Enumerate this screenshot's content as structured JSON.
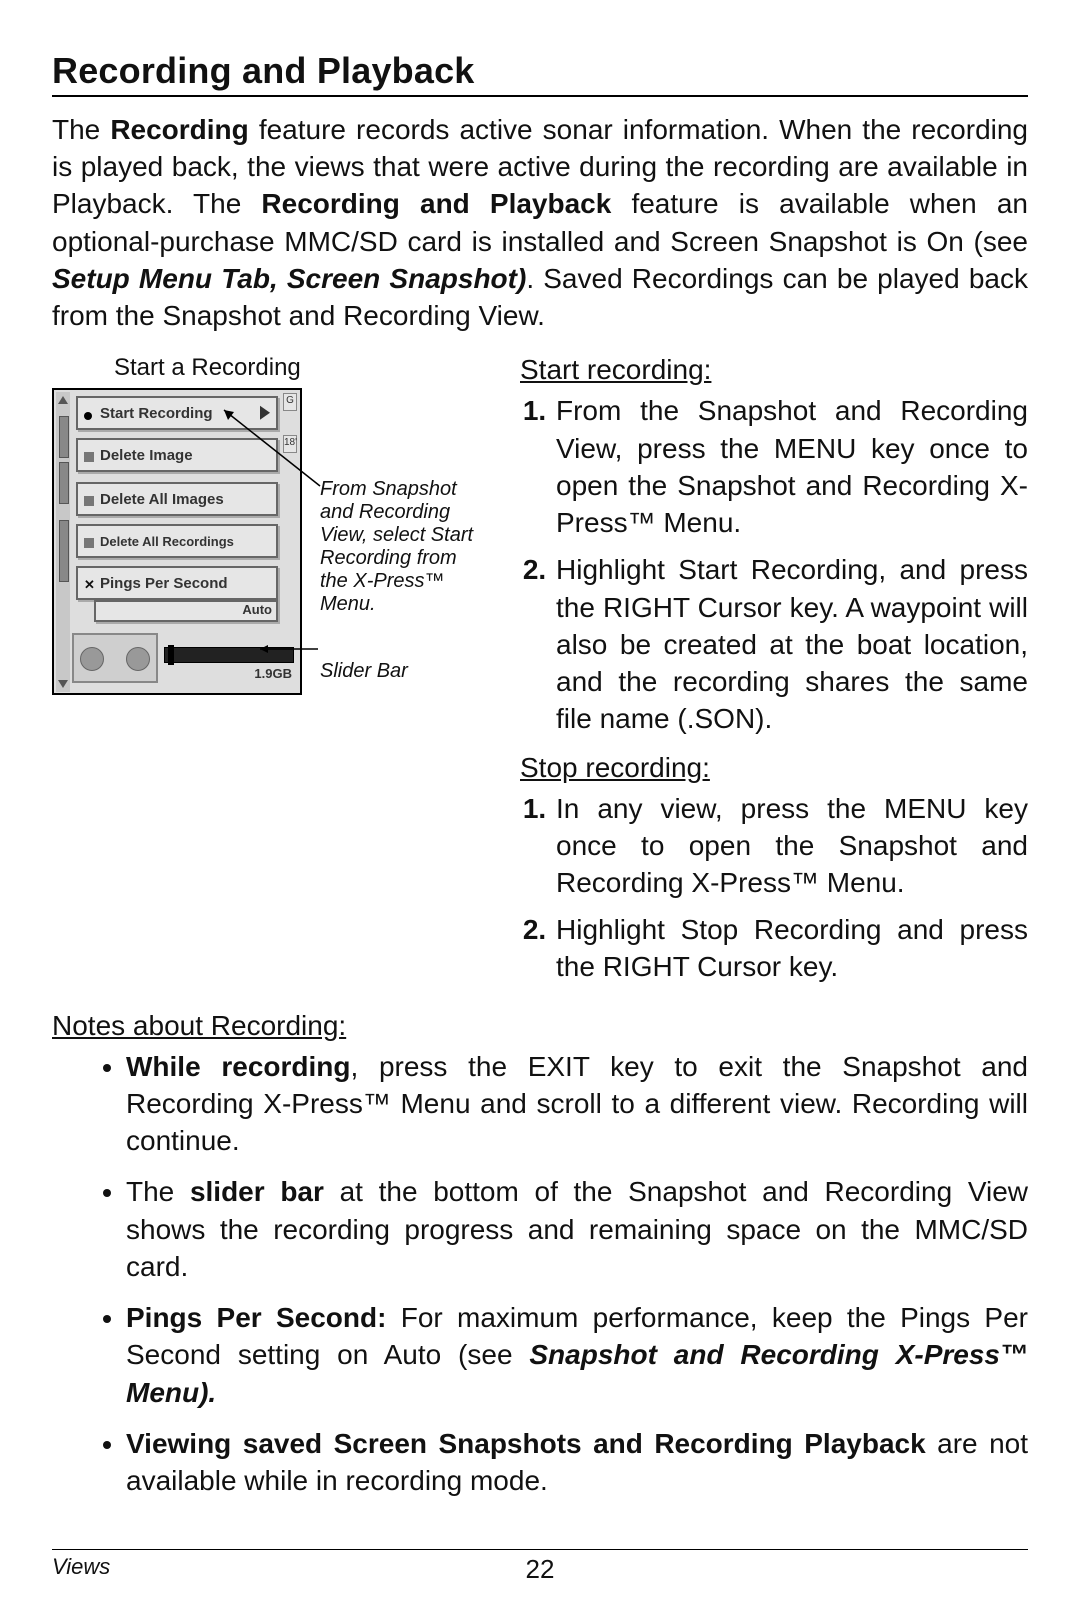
{
  "title": "Recording and Playback",
  "intro": {
    "t1": "The ",
    "b1": "Recording",
    "t2": " feature records active sonar information. When the recording is played back, the views that were active during the recording are available in Playback. The ",
    "b2": "Recording and Playback",
    "t3": " feature is available when an optional-purchase MMC/SD card is installed and Screen Snapshot is On (see ",
    "bi1": "Setup Menu Tab, Screen Snapshot)",
    "t4": ". Saved Recordings can be played back from the Snapshot and Recording View."
  },
  "figure": {
    "caption": "Start a Recording",
    "menu": {
      "start": "Start Recording",
      "del_img": "Delete Image",
      "del_all_img": "Delete All Images",
      "del_all_rec": "Delete All Recordings",
      "pps": "Pings Per Second",
      "auto": "Auto",
      "gb": "1.9GB",
      "rightG": "G",
      "right18": "18'"
    },
    "annot1": "From Snapshot and Recording View, select Start Recording from the\nX-Press™ Menu.",
    "annot2": "Slider Bar"
  },
  "start": {
    "heading": "Start recording:",
    "s1": "From the Snapshot and Recording View, press the MENU key once to open the Snapshot and Recording X-Press™ Menu.",
    "s2": "Highlight Start Recording, and press the RIGHT Cursor key. A waypoint will also be created at the boat location, and the recording shares the same file name (.SON)."
  },
  "stop": {
    "heading": "Stop recording:",
    "s1": "In any view, press the MENU key once to open the Snapshot and Recording X-Press™ Menu.",
    "s2": "Highlight Stop Recording and press the RIGHT Cursor key."
  },
  "notes": {
    "heading": "Notes about Recording:",
    "n1a": "While recording",
    "n1b": ", press the EXIT key to exit the Snapshot and Recording X-Press™ Menu and scroll to a different view. Recording will continue.",
    "n2a": "The ",
    "n2b": "slider bar",
    "n2c": " at the bottom of the Snapshot and Recording View shows the recording progress and remaining space on the MMC/SD card.",
    "n3a": "Pings Per Second:",
    "n3b": " For maximum performance, keep the Pings Per Second setting on Auto (see  ",
    "n3c": "Snapshot and Recording X-Press™ Menu).",
    "n4a": "Viewing saved Screen Snapshots and Recording Playback",
    "n4b": " are not available while in recording mode."
  },
  "footer": {
    "left": "Views",
    "page": "22"
  }
}
